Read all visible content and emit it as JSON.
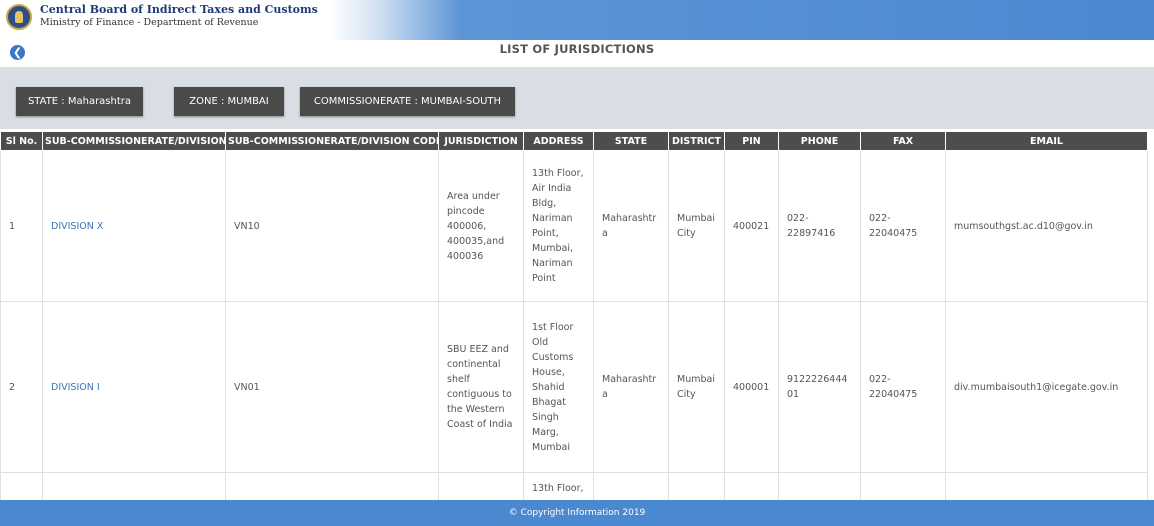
{
  "header": {
    "org_name": "Central Board of Indirect Taxes and Customs",
    "org_subtitle": "Ministry of Finance - Department of Revenue"
  },
  "page": {
    "back_icon": "back-arrow-icon",
    "title": "LIST OF JURISDICTIONS"
  },
  "filters": {
    "state": "STATE : Maharashtra",
    "zone": "ZONE : MUMBAI",
    "commissionerate": "COMMISSIONERATE : MUMBAI-SOUTH"
  },
  "table": {
    "headers": [
      "Sl No.",
      "SUB-COMMISSIONERATE/DIVISION",
      "SUB-COMMISSIONERATE/DIVISION CODE",
      "JURISDICTION",
      "ADDRESS",
      "STATE",
      "DISTRICT",
      "PIN",
      "PHONE",
      "FAX",
      "EMAIL"
    ],
    "rows": [
      {
        "sl": "1",
        "division": "DIVISION X",
        "code": "VN10",
        "jurisdiction": "Area under pincode 400006, 400035,and 400036",
        "address": "13th Floor, Air India Bldg, Nariman Point, Mumbai, Nariman Point",
        "state": "Maharashtra",
        "district": "Mumbai City",
        "pin": "400021",
        "phone": "022-22897416",
        "fax": "022-22040475",
        "email": "mumsouthgst.ac.d10@gov.in"
      },
      {
        "sl": "2",
        "division": "DIVISION I",
        "code": "VN01",
        "jurisdiction": "SBU EEZ and continental shelf contiguous to the Western Coast of India",
        "address": "1st Floor Old Customs House, Shahid Bhagat Singh Marg, Mumbai",
        "state": "Maharashtra",
        "district": "Mumbai City",
        "pin": "400001",
        "phone": "912222644401",
        "fax": "022-22040475",
        "email": "div.mumbaisouth1@icegate.gov.in"
      },
      {
        "sl": "",
        "division": "",
        "code": "",
        "jurisdiction": "",
        "address": "13th Floor,",
        "state": "",
        "district": "",
        "pin": "",
        "phone": "",
        "fax": "",
        "email": ""
      }
    ]
  },
  "footer": {
    "copyright": "© Copyright Information 2019"
  },
  "colors": {
    "header_blue": "#4a88d0",
    "table_header": "#4d4d4d",
    "filter_band": "#d9dee4",
    "link": "#3b73b9"
  }
}
